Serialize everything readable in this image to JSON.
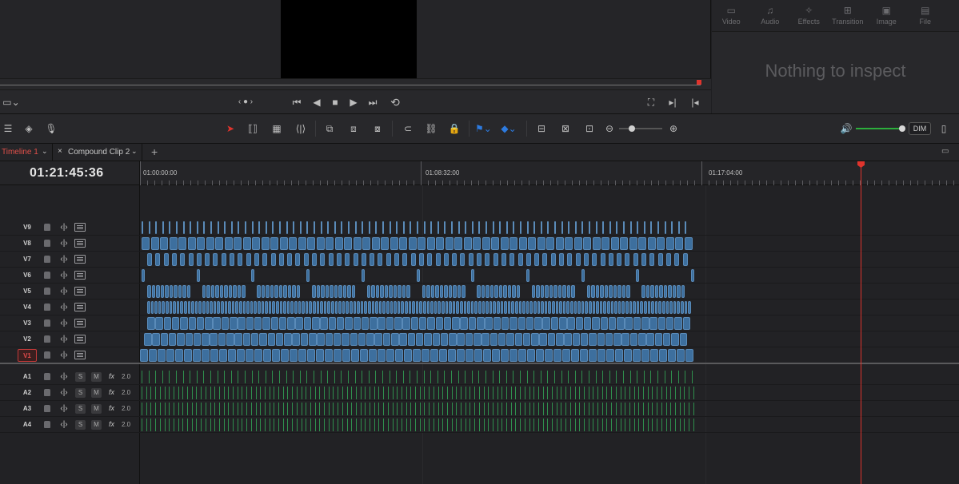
{
  "viewer": {
    "transport": {
      "first_frame": "⏮",
      "prev": "◀",
      "stop": "■",
      "play": "▶",
      "last_frame": "⏭",
      "loop": "⟲",
      "jog": "‹ ● ›"
    }
  },
  "inspector": {
    "tabs": [
      {
        "label": "Video",
        "icon": "video-icon"
      },
      {
        "label": "Audio",
        "icon": "music-note-icon"
      },
      {
        "label": "Effects",
        "icon": "magic-wand-icon"
      },
      {
        "label": "Transition",
        "icon": "transition-icon"
      },
      {
        "label": "Image",
        "icon": "image-icon"
      },
      {
        "label": "File",
        "icon": "file-icon"
      }
    ],
    "empty_message": "Nothing to inspect"
  },
  "toolbar": {
    "dim_label": "DIM"
  },
  "tabs": [
    {
      "label": "Timeline 1",
      "color": "#e0504a"
    },
    {
      "label": "Compound Clip 2",
      "color": "#c8c8c8"
    }
  ],
  "add_tab_label": "+",
  "timecode": "01:21:45:36",
  "ruler": {
    "labels": [
      "01:00:00:00",
      "01:08:32:00",
      "01:17:04:00"
    ]
  },
  "video_tracks": [
    {
      "name": "V9"
    },
    {
      "name": "V8"
    },
    {
      "name": "V7"
    },
    {
      "name": "V6"
    },
    {
      "name": "V5"
    },
    {
      "name": "V4"
    },
    {
      "name": "V3"
    },
    {
      "name": "V2"
    },
    {
      "name": "V1",
      "active": true
    }
  ],
  "audio_tracks": [
    {
      "name": "A1",
      "solo": "S",
      "mute": "M",
      "fx": "fx",
      "channels": "2.0"
    },
    {
      "name": "A2",
      "solo": "S",
      "mute": "M",
      "fx": "fx",
      "channels": "2.0"
    },
    {
      "name": "A3",
      "solo": "S",
      "mute": "M",
      "fx": "fx",
      "channels": "2.0"
    },
    {
      "name": "A4",
      "solo": "S",
      "mute": "M",
      "fx": "fx",
      "channels": "2.0"
    }
  ],
  "colors": {
    "clip_video": "#3d6f9e",
    "clip_audio": "#2f8f4d",
    "playhead": "#e0342d",
    "volume": "#2cae3c",
    "active_timeline": "#e0504a"
  }
}
